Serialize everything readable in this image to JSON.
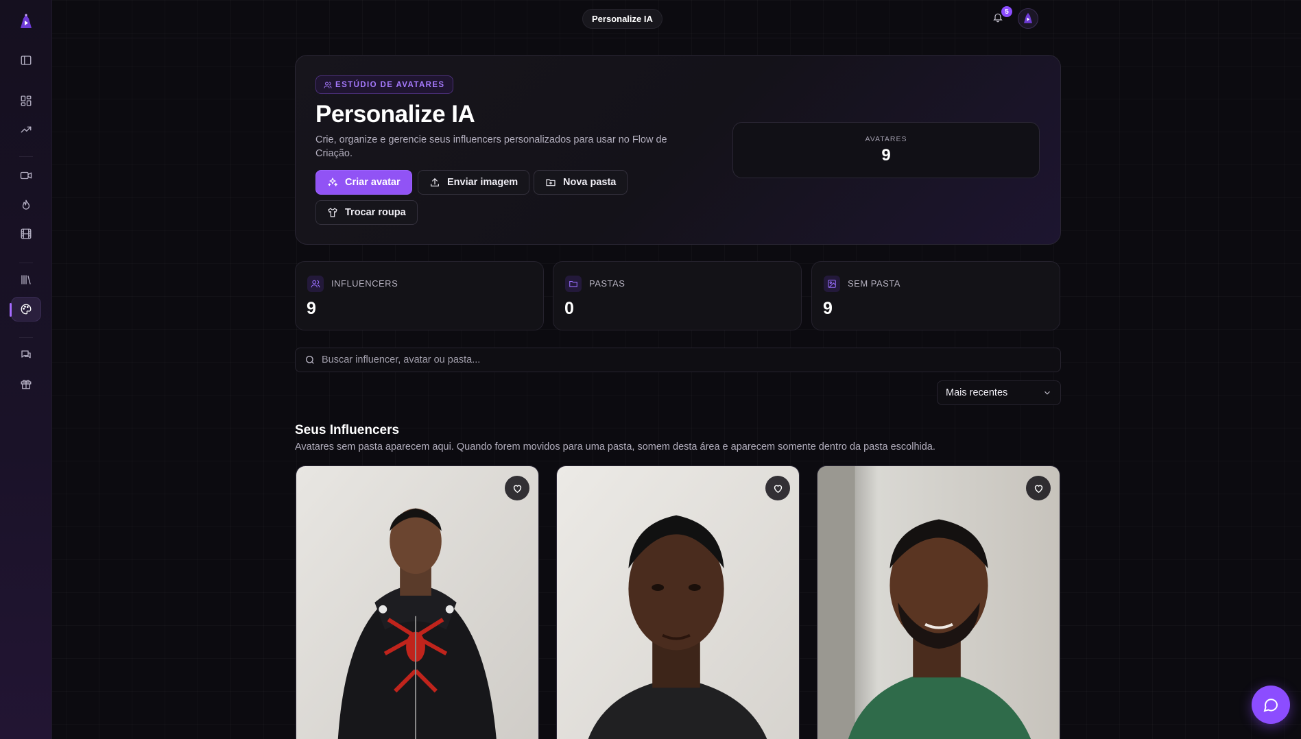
{
  "topbar": {
    "page_pill": "Personalize IA",
    "notification_count": "5"
  },
  "hero": {
    "tag": "ESTÚDIO DE AVATARES",
    "title": "Personalize IA",
    "description": "Crie, organize e gerencie seus influencers personalizados para usar no Flow de Criação.",
    "buttons": {
      "create": "Criar avatar",
      "upload": "Enviar imagem",
      "new_folder": "Nova pasta",
      "change_outfit": "Trocar roupa"
    },
    "stat": {
      "label": "AVATARES",
      "value": "9"
    }
  },
  "stats": [
    {
      "label": "INFLUENCERS",
      "value": "9",
      "icon": "users-icon"
    },
    {
      "label": "PASTAS",
      "value": "0",
      "icon": "folder-icon"
    },
    {
      "label": "SEM PASTA",
      "value": "9",
      "icon": "image-icon"
    }
  ],
  "search": {
    "placeholder": "Buscar influencer, avatar ou pasta..."
  },
  "sort": {
    "selected": "Mais recentes"
  },
  "section": {
    "title": "Seus Influencers",
    "subtitle": "Avatares sem pasta aparecem aqui. Quando forem movidos para uma pasta, somem desta área e aparecem somente dentro da pasta escolhida."
  },
  "colors": {
    "accent": "#9153f5",
    "background": "#0c0b10"
  }
}
